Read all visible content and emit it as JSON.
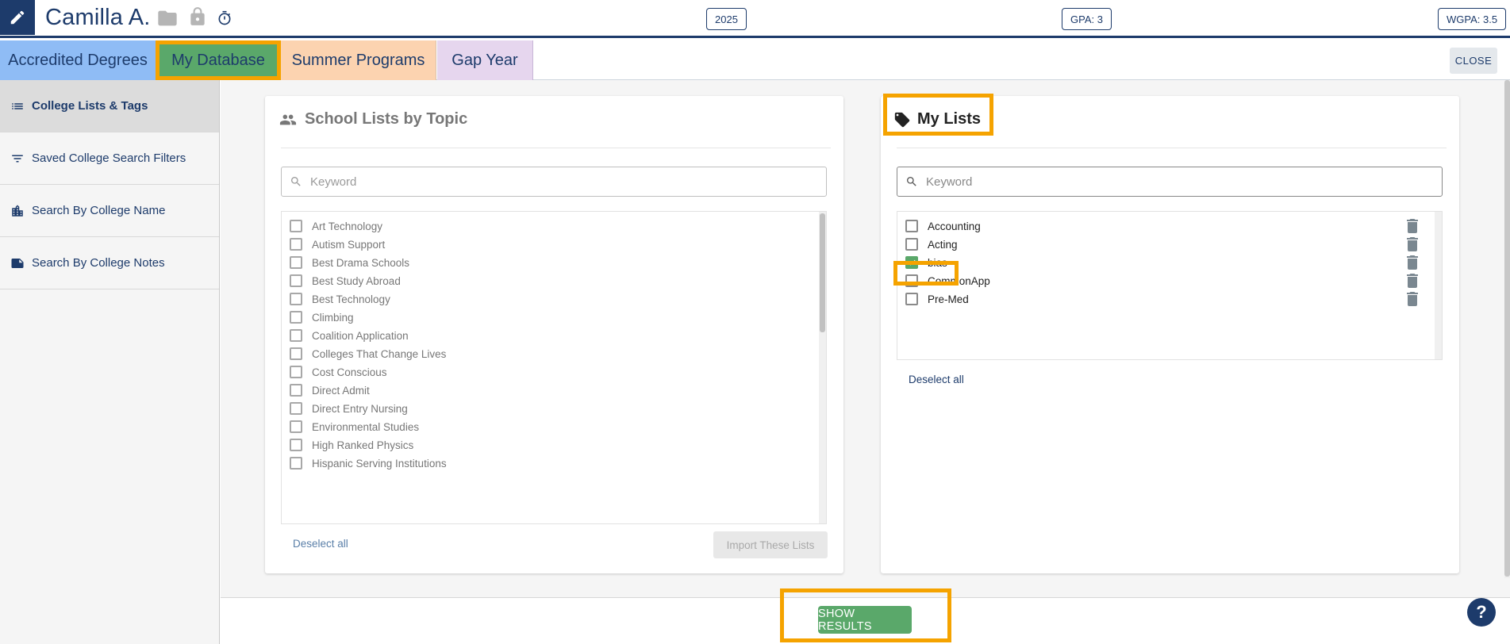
{
  "header": {
    "student_name": "Camilla A.",
    "grad_year": "2025",
    "gpa": "GPA: 3",
    "wgpa": "WGPA: 3.5",
    "icons": [
      "pencil-icon",
      "folder-icon",
      "lock-icon",
      "stopwatch-icon"
    ]
  },
  "tabs": [
    {
      "label": "Accredited Degrees",
      "color": "#8fbcf5"
    },
    {
      "label": "My Database",
      "color": "#5aa86a"
    },
    {
      "label": "Summer Programs",
      "color": "#fcd3b0"
    },
    {
      "label": "Gap Year",
      "color": "#e6d6ee"
    }
  ],
  "close_label": "CLOSE",
  "sidebar": {
    "items": [
      {
        "label": "College Lists & Tags",
        "icon": "list-icon",
        "active": true
      },
      {
        "label": "Saved College Search Filters",
        "icon": "filter-icon",
        "active": false
      },
      {
        "label": "Search By College Name",
        "icon": "building-icon",
        "active": false
      },
      {
        "label": "Search By College Notes",
        "icon": "note-icon",
        "active": false
      }
    ]
  },
  "topic_lists": {
    "title": "School Lists by Topic",
    "search_placeholder": "Keyword",
    "items": [
      "Art Technology",
      "Autism Support",
      "Best Drama Schools",
      "Best Study Abroad",
      "Best Technology",
      "Climbing",
      "Coalition Application",
      "Colleges That Change Lives",
      "Cost Conscious",
      "Direct Admit",
      "Direct Entry Nursing",
      "Environmental Studies",
      "High Ranked Physics",
      "Hispanic Serving Institutions"
    ],
    "deselect_label": "Deselect all",
    "import_label": "Import These Lists"
  },
  "my_lists": {
    "title": "My Lists",
    "search_placeholder": "Keyword",
    "items": [
      {
        "label": "Accounting",
        "checked": false
      },
      {
        "label": "Acting",
        "checked": false
      },
      {
        "label": "bias",
        "checked": true
      },
      {
        "label": "CommonApp",
        "checked": false
      },
      {
        "label": "Pre-Med",
        "checked": false
      }
    ],
    "deselect_label": "Deselect all"
  },
  "footer": {
    "show_results_label": "SHOW RESULTS",
    "help_label": "?"
  },
  "colors": {
    "brand_navy": "#1d3b6b",
    "accent_green": "#5aa86a",
    "highlight_orange": "#f5a300"
  }
}
